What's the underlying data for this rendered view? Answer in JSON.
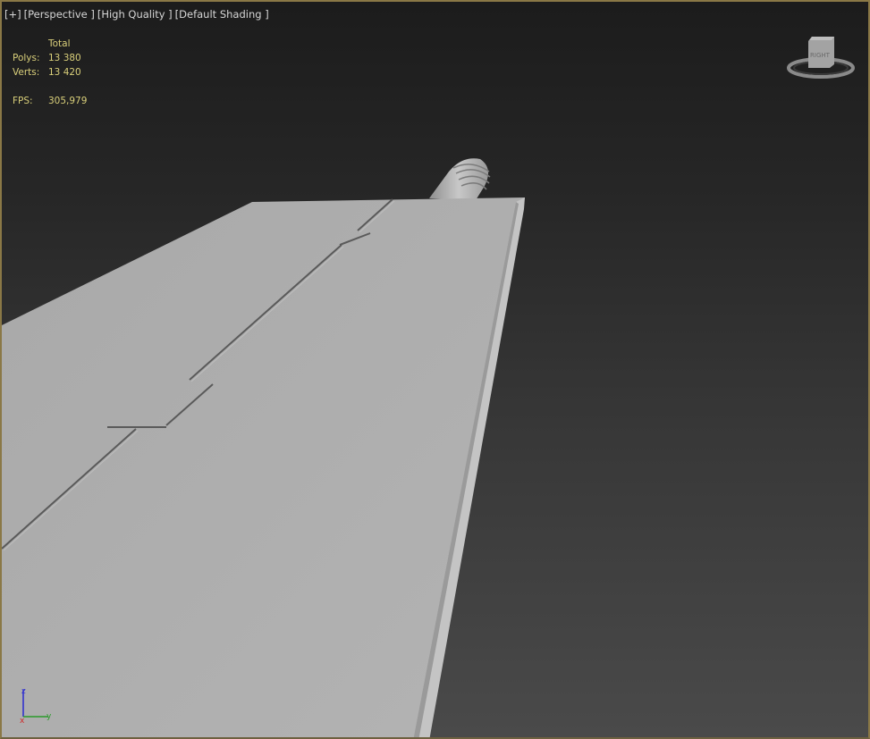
{
  "viewport": {
    "labels": [
      "[+]",
      "[Perspective ]",
      "[High Quality ]",
      "[Default Shading ]"
    ]
  },
  "stats": {
    "header": "Total",
    "polys_label": "Polys:",
    "polys_value": "13 380",
    "verts_label": "Verts:",
    "verts_value": "13 420",
    "fps_label": "FPS:",
    "fps_value": "305,979"
  },
  "viewcube": {
    "face": "RIGHT"
  },
  "axis_triad": {
    "z": "z",
    "y": "y",
    "x": "x"
  },
  "colors": {
    "border": "#8a7846",
    "stats": "#d9cf7a",
    "labels": "#d6d6d6"
  }
}
